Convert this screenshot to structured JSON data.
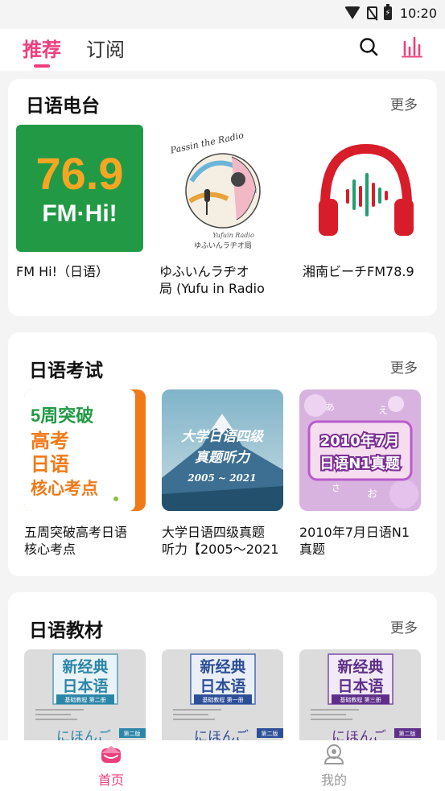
{
  "status_bar": {
    "time": "10:20"
  },
  "top_nav": {
    "tabs": [
      {
        "label": "推荐",
        "active": true
      },
      {
        "label": "订阅",
        "active": false
      }
    ],
    "icons": [
      "search-icon",
      "chart-icon"
    ]
  },
  "sections": [
    {
      "title": "日语电台",
      "more": "更多",
      "items": [
        {
          "label": "FM Hi!（日语）",
          "cover": {
            "big": "76.9",
            "small": "FM·Hi!"
          }
        },
        {
          "label": "ゆふいんラヂオ\n局 (Yufu in Radio",
          "cover": {
            "top": "Passin the Radio",
            "bottom": "ゆふいんラヂオ局",
            "mid": "Yufuin Radio"
          }
        },
        {
          "label": "湘南ビーチFM78.9",
          "cover": {}
        }
      ]
    },
    {
      "title": "日语考试",
      "more": "更多",
      "items": [
        {
          "label": "五周突破高考日语\n核心考点",
          "cover": {
            "line1": "5周突破",
            "line2": "高考",
            "line3": "日语",
            "line4": "核心考点"
          }
        },
        {
          "label": "大学日语四级真题\n听力【2005～2021",
          "cover": {
            "line1": "大学日语四级",
            "line2": "真题听力",
            "line3": "2005 ~ 2021"
          }
        },
        {
          "label": "2010年7月日语N1\n真题",
          "cover": {
            "line1": "2010年7月",
            "line2": "日语N1真题",
            "kana1": "あ",
            "kana2": "え",
            "kana3": "さ",
            "kana4": "お"
          }
        }
      ]
    },
    {
      "title": "日语教材",
      "more": "更多",
      "items": [
        {
          "label": "",
          "cover": {
            "line1": "新经典",
            "line2": "日本语",
            "line3": "基础教程 第二册",
            "kana": "にほんご",
            "edition": "第二版"
          }
        },
        {
          "label": "",
          "cover": {
            "line1": "新经典",
            "line2": "日本语",
            "line3": "基础教程 第一册",
            "kana": "にほんご",
            "edition": "第二版"
          }
        },
        {
          "label": "",
          "cover": {
            "line1": "新经典",
            "line2": "日本语",
            "line3": "基础教程 第三册",
            "kana": "にほんご",
            "edition": "第二版"
          }
        }
      ]
    }
  ],
  "bottom_nav": [
    {
      "label": "首页",
      "active": true,
      "icon": "home-icon"
    },
    {
      "label": "我的",
      "active": false,
      "icon": "user-icon"
    }
  ],
  "colors": {
    "accent": "#ee3f7d",
    "orange": "#f07a1a",
    "green": "#229a45"
  }
}
